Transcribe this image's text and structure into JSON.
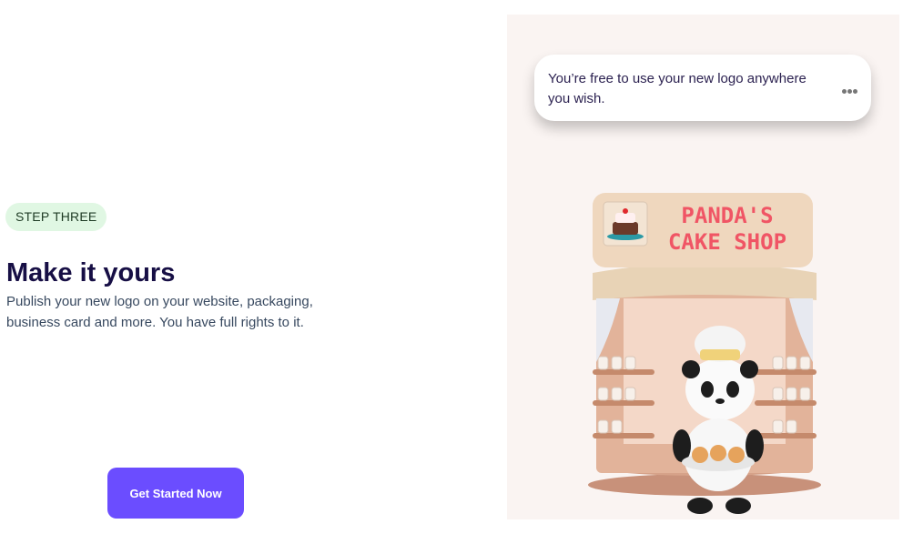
{
  "step": {
    "badge": "STEP THREE"
  },
  "main": {
    "title": "Make it yours",
    "description": "Publish your new logo on your website, packaging, business card and more. You have full rights to it."
  },
  "cta": {
    "label": "Get Started Now"
  },
  "panel": {
    "bubble_text": "You’re free to use your new logo anywhere you wish.",
    "sign_line1": "PANDA'S",
    "sign_line2": "CAKE SHOP"
  },
  "colors": {
    "accent": "#6b4dff",
    "badge_bg": "#e0f7e3",
    "sign_text": "#f05565"
  },
  "icons": {
    "menu": "more-dots-icon",
    "logo": "cake-icon"
  }
}
